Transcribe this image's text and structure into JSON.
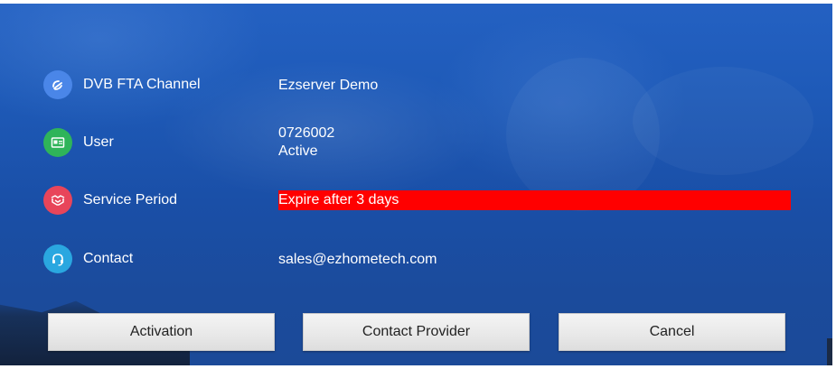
{
  "rows": {
    "channel": {
      "icon": "satellite-dish-icon",
      "icon_color": "#4a86e8",
      "label": "DVB FTA Channel",
      "value": "Ezserver Demo"
    },
    "user": {
      "icon": "id-card-icon",
      "icon_color": "#2fb45a",
      "label": "User",
      "value_line1": "0726002",
      "value_line2": "Active"
    },
    "service": {
      "icon": "handshake-icon",
      "icon_color": "#e8455a",
      "label": "Service Period",
      "value": "Expire after 3 days",
      "highlight_color": "#ff0000"
    },
    "contact": {
      "icon": "headset-icon",
      "icon_color": "#2aa7e0",
      "label": "Contact",
      "value": "sales@ezhometech.com"
    }
  },
  "buttons": {
    "activation": "Activation",
    "contact_provider": "Contact Provider",
    "cancel": "Cancel"
  }
}
